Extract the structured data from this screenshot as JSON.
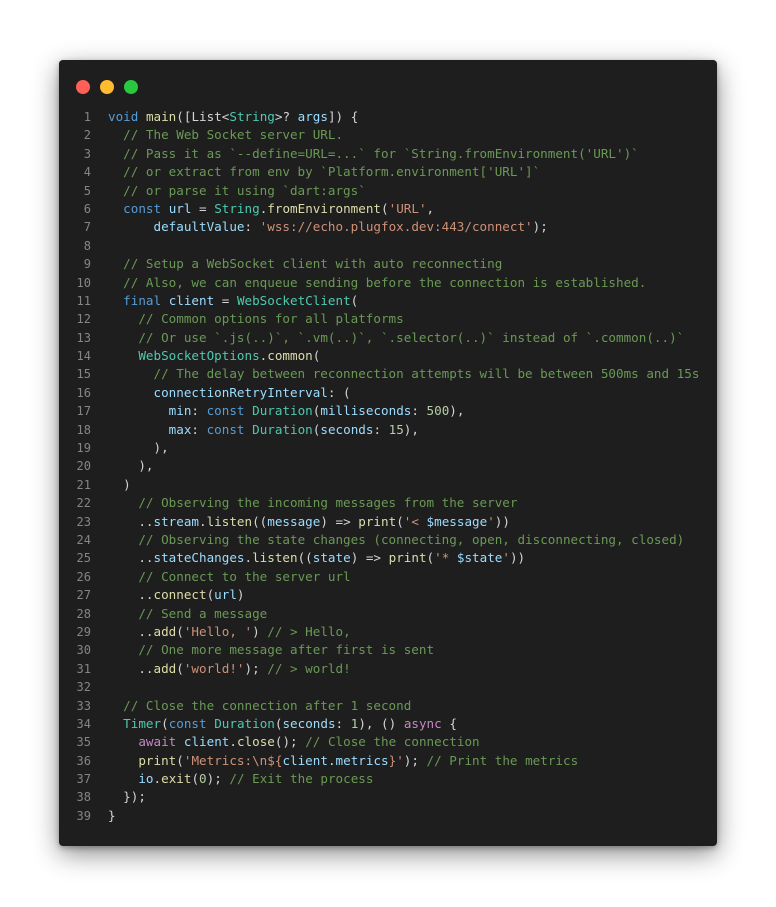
{
  "window": {
    "controls": [
      "close",
      "minimize",
      "maximize"
    ],
    "colors": {
      "close": "#ff5f57",
      "minimize": "#febc2e",
      "maximize": "#28c840",
      "background": "#1e1e1e"
    }
  },
  "code": {
    "language": "dart",
    "lines": [
      [
        [
          "k",
          "void"
        ],
        [
          "p",
          " "
        ],
        [
          "f",
          "main"
        ],
        [
          "p",
          "([List<"
        ],
        [
          "t",
          "String"
        ],
        [
          "p",
          ">? "
        ],
        [
          "v",
          "args"
        ],
        [
          "p",
          "]) {"
        ]
      ],
      [
        [
          "p",
          "  "
        ],
        [
          "c",
          "// The Web Socket server URL."
        ]
      ],
      [
        [
          "p",
          "  "
        ],
        [
          "c",
          "// Pass it as `--define=URL=...` for `String.fromEnvironment('URL')`"
        ]
      ],
      [
        [
          "p",
          "  "
        ],
        [
          "c",
          "// or extract from env by `Platform.environment['URL']`"
        ]
      ],
      [
        [
          "p",
          "  "
        ],
        [
          "c",
          "// or parse it using `dart:args`"
        ]
      ],
      [
        [
          "p",
          "  "
        ],
        [
          "k",
          "const"
        ],
        [
          "p",
          " "
        ],
        [
          "v",
          "url"
        ],
        [
          "p",
          " = "
        ],
        [
          "t",
          "String"
        ],
        [
          "p",
          "."
        ],
        [
          "f",
          "fromEnvironment"
        ],
        [
          "p",
          "("
        ],
        [
          "s",
          "'URL'"
        ],
        [
          "p",
          ","
        ]
      ],
      [
        [
          "p",
          "      "
        ],
        [
          "v",
          "defaultValue"
        ],
        [
          "p",
          ": "
        ],
        [
          "s",
          "'wss://echo.plugfox.dev:443/connect'"
        ],
        [
          "p",
          ");"
        ]
      ],
      [],
      [
        [
          "p",
          "  "
        ],
        [
          "c",
          "// Setup a WebSocket client with auto reconnecting"
        ]
      ],
      [
        [
          "p",
          "  "
        ],
        [
          "c",
          "// Also, we can enqueue sending before the connection is established."
        ]
      ],
      [
        [
          "p",
          "  "
        ],
        [
          "k",
          "final"
        ],
        [
          "p",
          " "
        ],
        [
          "v",
          "client"
        ],
        [
          "p",
          " = "
        ],
        [
          "t",
          "WebSocketClient"
        ],
        [
          "p",
          "("
        ]
      ],
      [
        [
          "p",
          "    "
        ],
        [
          "c",
          "// Common options for all platforms"
        ]
      ],
      [
        [
          "p",
          "    "
        ],
        [
          "c",
          "// Or use `.js(..)`, `.vm(..)`, `.selector(..)` instead of `.common(..)`"
        ]
      ],
      [
        [
          "p",
          "    "
        ],
        [
          "t",
          "WebSocketOptions"
        ],
        [
          "p",
          "."
        ],
        [
          "f",
          "common"
        ],
        [
          "p",
          "("
        ]
      ],
      [
        [
          "p",
          "      "
        ],
        [
          "c",
          "// The delay between reconnection attempts will be between 500ms and 15s"
        ]
      ],
      [
        [
          "p",
          "      "
        ],
        [
          "v",
          "connectionRetryInterval"
        ],
        [
          "p",
          ": ("
        ]
      ],
      [
        [
          "p",
          "        "
        ],
        [
          "v",
          "min"
        ],
        [
          "p",
          ": "
        ],
        [
          "k",
          "const"
        ],
        [
          "p",
          " "
        ],
        [
          "t",
          "Duration"
        ],
        [
          "p",
          "("
        ],
        [
          "v",
          "milliseconds"
        ],
        [
          "p",
          ": "
        ],
        [
          "n",
          "500"
        ],
        [
          "p",
          "),"
        ]
      ],
      [
        [
          "p",
          "        "
        ],
        [
          "v",
          "max"
        ],
        [
          "p",
          ": "
        ],
        [
          "k",
          "const"
        ],
        [
          "p",
          " "
        ],
        [
          "t",
          "Duration"
        ],
        [
          "p",
          "("
        ],
        [
          "v",
          "seconds"
        ],
        [
          "p",
          ": "
        ],
        [
          "n",
          "15"
        ],
        [
          "p",
          "),"
        ]
      ],
      [
        [
          "p",
          "      ),"
        ]
      ],
      [
        [
          "p",
          "    ),"
        ]
      ],
      [
        [
          "p",
          "  )"
        ]
      ],
      [
        [
          "p",
          "    "
        ],
        [
          "c",
          "// Observing the incoming messages from the server"
        ]
      ],
      [
        [
          "p",
          "    .."
        ],
        [
          "v",
          "stream"
        ],
        [
          "p",
          "."
        ],
        [
          "f",
          "listen"
        ],
        [
          "p",
          "(("
        ],
        [
          "v",
          "message"
        ],
        [
          "p",
          ") => "
        ],
        [
          "f",
          "print"
        ],
        [
          "p",
          "("
        ],
        [
          "s",
          "'< "
        ],
        [
          "v",
          "$message"
        ],
        [
          "s",
          "'"
        ],
        [
          "p",
          "))"
        ]
      ],
      [
        [
          "p",
          "    "
        ],
        [
          "c",
          "// Observing the state changes (connecting, open, disconnecting, closed)"
        ]
      ],
      [
        [
          "p",
          "    .."
        ],
        [
          "v",
          "stateChanges"
        ],
        [
          "p",
          "."
        ],
        [
          "f",
          "listen"
        ],
        [
          "p",
          "(("
        ],
        [
          "v",
          "state"
        ],
        [
          "p",
          ") => "
        ],
        [
          "f",
          "print"
        ],
        [
          "p",
          "("
        ],
        [
          "s",
          "'* "
        ],
        [
          "v",
          "$state"
        ],
        [
          "s",
          "'"
        ],
        [
          "p",
          "))"
        ]
      ],
      [
        [
          "p",
          "    "
        ],
        [
          "c",
          "// Connect to the server url"
        ]
      ],
      [
        [
          "p",
          "    .."
        ],
        [
          "f",
          "connect"
        ],
        [
          "p",
          "("
        ],
        [
          "v",
          "url"
        ],
        [
          "p",
          ")"
        ]
      ],
      [
        [
          "p",
          "    "
        ],
        [
          "c",
          "// Send a message"
        ]
      ],
      [
        [
          "p",
          "    .."
        ],
        [
          "f",
          "add"
        ],
        [
          "p",
          "("
        ],
        [
          "s",
          "'Hello, '"
        ],
        [
          "p",
          ") "
        ],
        [
          "c",
          "// > Hello,"
        ]
      ],
      [
        [
          "p",
          "    "
        ],
        [
          "c",
          "// One more message after first is sent"
        ]
      ],
      [
        [
          "p",
          "    .."
        ],
        [
          "f",
          "add"
        ],
        [
          "p",
          "("
        ],
        [
          "s",
          "'world!'"
        ],
        [
          "p",
          "); "
        ],
        [
          "c",
          "// > world!"
        ]
      ],
      [],
      [
        [
          "p",
          "  "
        ],
        [
          "c",
          "// Close the connection after 1 second"
        ]
      ],
      [
        [
          "p",
          "  "
        ],
        [
          "t",
          "Timer"
        ],
        [
          "p",
          "("
        ],
        [
          "k",
          "const"
        ],
        [
          "p",
          " "
        ],
        [
          "t",
          "Duration"
        ],
        [
          "p",
          "("
        ],
        [
          "v",
          "seconds"
        ],
        [
          "p",
          ": "
        ],
        [
          "n",
          "1"
        ],
        [
          "p",
          "), () "
        ],
        [
          "m",
          "async"
        ],
        [
          "p",
          " {"
        ]
      ],
      [
        [
          "p",
          "    "
        ],
        [
          "m",
          "await"
        ],
        [
          "p",
          " "
        ],
        [
          "v",
          "client"
        ],
        [
          "p",
          "."
        ],
        [
          "f",
          "close"
        ],
        [
          "p",
          "(); "
        ],
        [
          "c",
          "// Close the connection"
        ]
      ],
      [
        [
          "p",
          "    "
        ],
        [
          "f",
          "print"
        ],
        [
          "p",
          "("
        ],
        [
          "s",
          "'Metrics:\\n${"
        ],
        [
          "v",
          "client"
        ],
        [
          "p",
          "."
        ],
        [
          "v",
          "metrics"
        ],
        [
          "s",
          "}'"
        ],
        [
          "p",
          "); "
        ],
        [
          "c",
          "// Print the metrics"
        ]
      ],
      [
        [
          "p",
          "    "
        ],
        [
          "v",
          "io"
        ],
        [
          "p",
          "."
        ],
        [
          "f",
          "exit"
        ],
        [
          "p",
          "("
        ],
        [
          "n",
          "0"
        ],
        [
          "p",
          "); "
        ],
        [
          "c",
          "// Exit the process"
        ]
      ],
      [
        [
          "p",
          "  });"
        ]
      ],
      [
        [
          "p",
          "}"
        ]
      ]
    ]
  }
}
